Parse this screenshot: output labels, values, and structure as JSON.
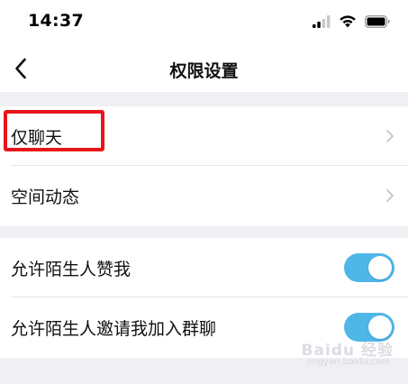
{
  "status_bar": {
    "time": "14:37",
    "icons": [
      "cellular-signal-icon",
      "wifi-icon",
      "battery-icon"
    ]
  },
  "nav": {
    "back_icon": "chevron-left-icon",
    "title": "权限设置"
  },
  "groups": [
    {
      "rows": [
        {
          "label": "仅聊天",
          "accessory": "chevron-right-icon",
          "highlighted": true
        },
        {
          "label": "空间动态",
          "accessory": "chevron-right-icon"
        }
      ]
    },
    {
      "rows": [
        {
          "label": "允许陌生人赞我",
          "accessory": "toggle",
          "on": true
        },
        {
          "label": "允许陌生人邀请我加入群聊",
          "accessory": "toggle",
          "on": true
        }
      ]
    }
  ],
  "watermark": {
    "brand": "Baidu 经验",
    "sub": "jingyan.baidu.com"
  },
  "colors": {
    "toggle_on": "#4fb6e8",
    "highlight_border": "#e8151b",
    "background": "#efeff4",
    "chevron": "#c4c4c9"
  }
}
